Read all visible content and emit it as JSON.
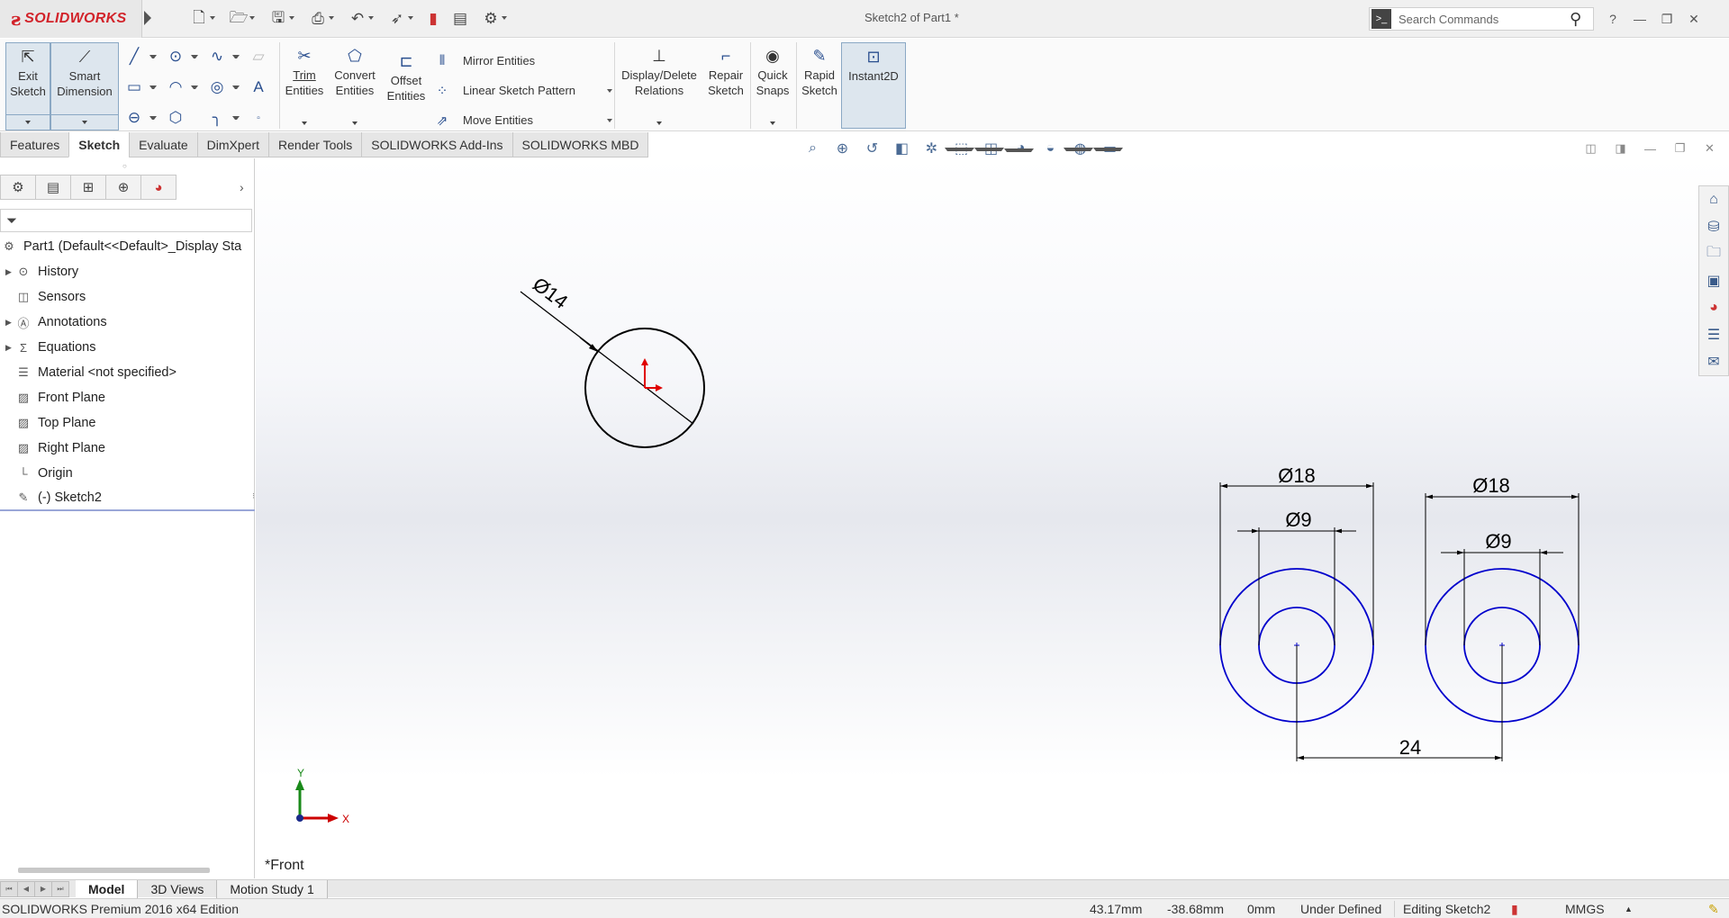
{
  "app": {
    "brand": "SOLIDWORKS",
    "document_title": "Sketch2 of Part1 *",
    "search_placeholder": "Search Commands",
    "help_label": "?",
    "brand_color": "#d2232a"
  },
  "quick_access": [
    "new-icon",
    "open-icon",
    "save-icon",
    "print-icon",
    "undo-icon",
    "select-icon",
    "rebuild-icon",
    "file-properties-icon",
    "options-icon"
  ],
  "command_manager": {
    "exit_sketch": [
      "Exit",
      "Sketch"
    ],
    "smart_dimension": [
      "Smart",
      "Dimension"
    ],
    "trim_entities": [
      "Trim",
      "Entities"
    ],
    "convert_entities": [
      "Convert",
      "Entities"
    ],
    "offset_entities": [
      "Offset",
      "Entities"
    ],
    "mirror_entities": "Mirror Entities",
    "linear_sketch_pattern": "Linear Sketch Pattern",
    "move_entities": "Move Entities",
    "display_delete_relations": [
      "Display/Delete",
      "Relations"
    ],
    "repair_sketch": [
      "Repair",
      "Sketch"
    ],
    "quick_snaps": [
      "Quick",
      "Snaps"
    ],
    "rapid_sketch": [
      "Rapid",
      "Sketch"
    ],
    "instant2d": "Instant2D"
  },
  "tabs": [
    "Features",
    "Sketch",
    "Evaluate",
    "DimXpert",
    "Render Tools",
    "SOLIDWORKS Add-Ins",
    "SOLIDWORKS MBD"
  ],
  "active_tab": "Sketch",
  "feature_tree": {
    "root": "Part1  (Default<<Default>_Display Sta",
    "items": [
      {
        "label": "History",
        "expandable": true,
        "icon": "history-icon"
      },
      {
        "label": "Sensors",
        "expandable": false,
        "icon": "sensors-icon"
      },
      {
        "label": "Annotations",
        "expandable": true,
        "icon": "annotations-icon"
      },
      {
        "label": "Equations",
        "expandable": true,
        "icon": "equations-icon"
      },
      {
        "label": "Material <not specified>",
        "expandable": false,
        "icon": "material-icon"
      },
      {
        "label": "Front Plane",
        "expandable": false,
        "icon": "plane-icon"
      },
      {
        "label": "Top Plane",
        "expandable": false,
        "icon": "plane-icon"
      },
      {
        "label": "Right Plane",
        "expandable": false,
        "icon": "plane-icon"
      },
      {
        "label": "Origin",
        "expandable": false,
        "icon": "origin-icon"
      },
      {
        "label": "(-) Sketch2",
        "expandable": false,
        "icon": "sketch-icon"
      }
    ]
  },
  "sketch": {
    "dimensions": {
      "left_circle": "Ø14",
      "outer_left": "Ø18",
      "inner_left": "Ø9",
      "outer_right": "Ø18",
      "inner_right": "Ø9",
      "center_distance": "24"
    },
    "triad_x": "X",
    "triad_y": "Y",
    "view_name": "*Front",
    "colors": {
      "geometry": "#0000cc",
      "fixed": "#000000",
      "triad_x": "#cc0000",
      "triad_y": "#1a8a1a"
    }
  },
  "bottom_tabs": [
    "Model",
    "3D Views",
    "Motion Study 1"
  ],
  "active_bottom_tab": "Model",
  "status": {
    "edition": "SOLIDWORKS Premium 2016 x64 Edition",
    "x": "43.17mm",
    "y": "-38.68mm",
    "z": "0mm",
    "state": "Under Defined",
    "editing": "Editing Sketch2",
    "units": "MMGS"
  }
}
